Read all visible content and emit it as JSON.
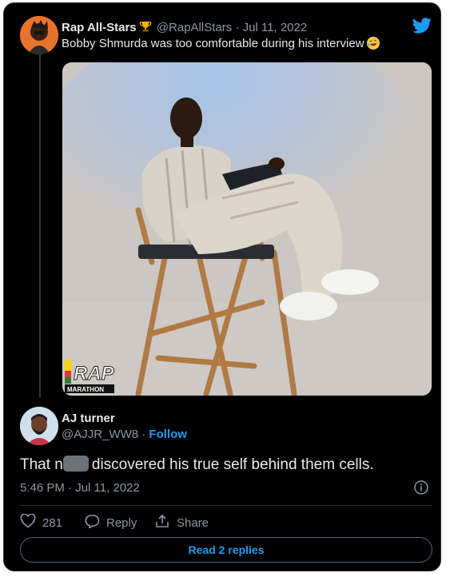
{
  "tweet": {
    "author_name": "Rap All-Stars",
    "author_handle": "@RapAllStars",
    "date": "· Jul 11, 2022",
    "text": "Bobby Shmurda was too comfortable during his interview",
    "icons": {
      "trophy": "trophy-icon",
      "emoji": "rolling-laughing-emoji",
      "brand": "twitter-bird-icon"
    },
    "media": {
      "watermark_top": "RAP",
      "watermark_bottom": "MARATHON"
    }
  },
  "reply": {
    "author_name": "AJ turner",
    "author_handle": "@AJJR_WW8 ·",
    "follow_label": "Follow",
    "text_before": "That n",
    "text_after": "discovered his true self behind them cells.",
    "timestamp": "5:46 PM · Jul 11, 2022",
    "likes": "281",
    "reply_label": "Reply",
    "share_label": "Share",
    "read_replies_label": "Read 2 replies"
  },
  "colors": {
    "accent": "#1d9bf0",
    "background": "#000000",
    "text": "#e7e9ea",
    "muted": "#8b98a5"
  }
}
